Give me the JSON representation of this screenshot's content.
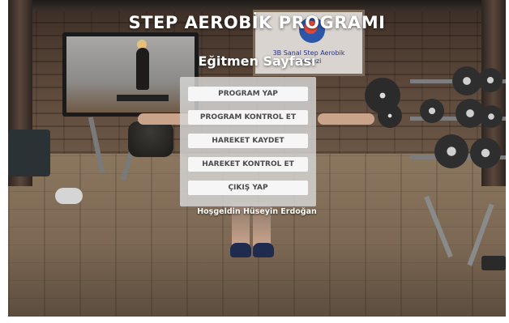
{
  "app": {
    "title": "STEP AEROBİK PROGRAMI"
  },
  "page": {
    "title": "Eğitmen Sayfası"
  },
  "poster": {
    "text_line1": "3B Sanal Step Aerobik",
    "text_line2": "Merkezi"
  },
  "menu": {
    "buttons": [
      {
        "label": "PROGRAM YAP"
      },
      {
        "label": "PROGRAM KONTROL ET"
      },
      {
        "label": "HAREKET KAYDET"
      },
      {
        "label": "HAREKET KONTROL ET"
      },
      {
        "label": "ÇIKIŞ YAP"
      }
    ]
  },
  "welcome": {
    "text": "Hoşgeldin Hüseyin Erdoğan"
  },
  "colors": {
    "panel": "#d7d7d7",
    "button_bg": "#f6f6f6",
    "button_text": "#4a4a4a",
    "title_text": "#ffffff"
  }
}
